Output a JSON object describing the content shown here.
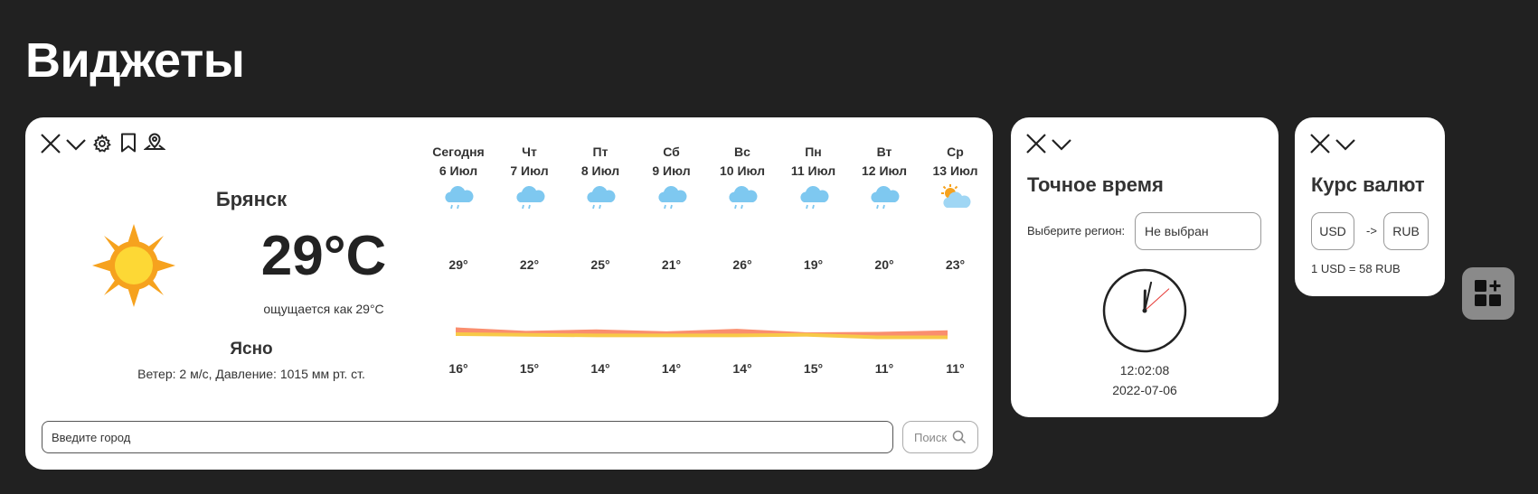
{
  "page": {
    "title": "Виджеты"
  },
  "weather": {
    "city": "Брянск",
    "temperature": "29°C",
    "feels_like": "ощущается как 29°C",
    "condition": "Ясно",
    "details": "Ветер: 2 м/с, Давление: 1015 мм рт. ст.",
    "current_icon": "sun-icon",
    "forecast": [
      {
        "day": "Сегодня",
        "date": "6 Июл",
        "icon": "rain-cloud-icon",
        "high": "29°",
        "low": "16°",
        "high_value": 29,
        "low_value": 16
      },
      {
        "day": "Чт",
        "date": "7 Июл",
        "icon": "rain-cloud-icon",
        "high": "22°",
        "low": "15°",
        "high_value": 22,
        "low_value": 15
      },
      {
        "day": "Пт",
        "date": "8 Июл",
        "icon": "rain-cloud-icon",
        "high": "25°",
        "low": "14°",
        "high_value": 25,
        "low_value": 14
      },
      {
        "day": "Сб",
        "date": "9 Июл",
        "icon": "rain-cloud-icon",
        "high": "21°",
        "low": "14°",
        "high_value": 21,
        "low_value": 14
      },
      {
        "day": "Вс",
        "date": "10 Июл",
        "icon": "rain-cloud-icon",
        "high": "26°",
        "low": "14°",
        "high_value": 26,
        "low_value": 14
      },
      {
        "day": "Пн",
        "date": "11 Июл",
        "icon": "rain-cloud-icon",
        "high": "19°",
        "low": "15°",
        "high_value": 19,
        "low_value": 15
      },
      {
        "day": "Вт",
        "date": "12 Июл",
        "icon": "rain-cloud-icon",
        "high": "20°",
        "low": "11°",
        "high_value": 20,
        "low_value": 11
      },
      {
        "day": "Ср",
        "date": "13 Июл",
        "icon": "partly-cloudy-icon",
        "high": "23°",
        "low": "11°",
        "high_value": 23,
        "low_value": 11
      }
    ],
    "search": {
      "placeholder": "Введите город",
      "button_label": "Поиск"
    },
    "band_colors": {
      "high": "#fa8e6e",
      "low": "#f7c948"
    }
  },
  "time_widget": {
    "title": "Точное время",
    "region_label": "Выберите регион:",
    "region_value": "Не выбран",
    "time": "12:02:08",
    "date": "2022-07-06",
    "clock": {
      "hours": 12,
      "minutes": 2,
      "seconds": 8
    }
  },
  "currency_widget": {
    "title": "Курс валют",
    "from": "USD",
    "arrow": "->",
    "to": "RUB",
    "rate": "1 USD = 58 RUB"
  },
  "colors": {
    "background": "#212121",
    "card": "#ffffff",
    "sun": "#f6a21e",
    "sun_core": "#fdd835",
    "cloud": "#7ec8f0",
    "add_button": "#8a8a8a"
  }
}
